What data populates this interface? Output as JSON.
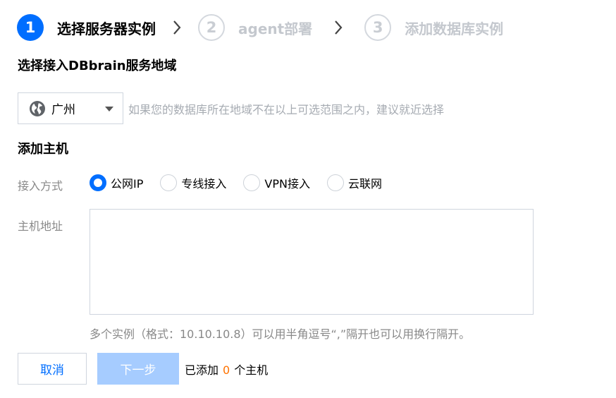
{
  "steps": [
    {
      "number": "1",
      "label": "选择服务器实例",
      "active": true
    },
    {
      "number": "2",
      "label": "agent部署",
      "active": false
    },
    {
      "number": "3",
      "label": "添加数据库实例",
      "active": false
    }
  ],
  "region": {
    "title": "选择接入DBbrain服务地域",
    "selected": "广州",
    "hint": "如果您的数据库所在地域不在以上可选范围之内，建议就近选择"
  },
  "host": {
    "title": "添加主机",
    "access_label": "接入方式",
    "access_options": [
      "公网IP",
      "专线接入",
      "VPN接入",
      "云联网"
    ],
    "access_selected": "公网IP",
    "address_label": "主机地址",
    "address_value": "",
    "help": "多个实例（格式：10.10.10.8）可以用半角逗号“,”隔开也可以用换行隔开。"
  },
  "actions": {
    "cancel_label": "取消",
    "next_label": "下一步",
    "added_prefix": "已添加",
    "added_count": "0",
    "added_suffix": "个主机"
  },
  "colors": {
    "primary": "#006eff",
    "disabled_primary": "#a6ccff",
    "count_highlight": "#ff7200"
  }
}
